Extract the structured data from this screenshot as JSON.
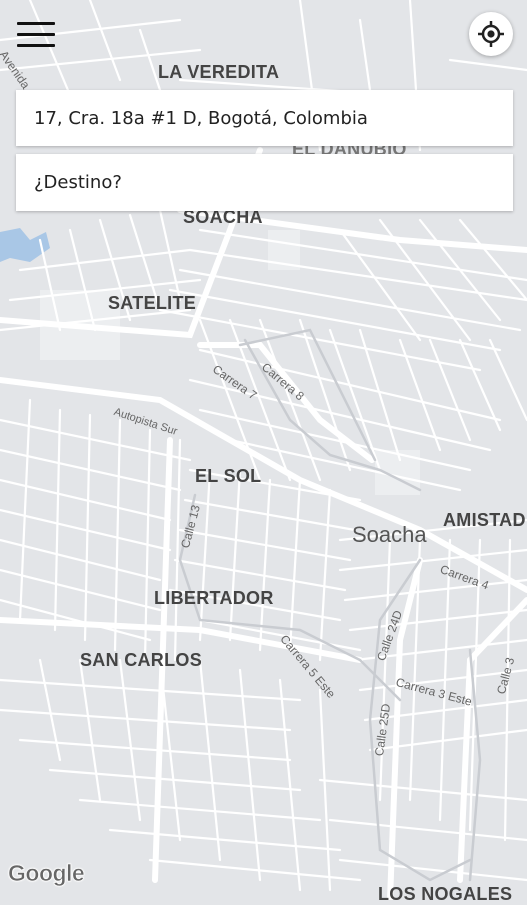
{
  "header": {
    "menu_icon": "hamburger-menu-icon",
    "locate_icon": "crosshair-location-icon"
  },
  "trip": {
    "origin_value": "17, Cra. 18a #1 D, Bogotá, Colombia",
    "destination_placeholder": "¿Destino?"
  },
  "map": {
    "neighborhoods": [
      "LA VEREDITA",
      "EL DANUBIO",
      "SOACHA",
      "SATELITE",
      "EL SOL",
      "AMISTAD",
      "LIBERTADOR",
      "SAN CARLOS",
      "LOS NOGALES"
    ],
    "town": "Soacha",
    "streets": [
      "Avenida",
      "Carrera 7",
      "Carrera 8",
      "Autopista Sur",
      "Calle 13",
      "Carrera 4",
      "Calle 24D",
      "Carrera 5 Este",
      "Carrera 3 Este",
      "Calle 25D",
      "Calle 3"
    ],
    "attribution": "Google",
    "colors": {
      "land": "#e3e5e8",
      "road": "#ffffff",
      "water": "#a9c7e6",
      "park": "#d6d9dd"
    }
  }
}
